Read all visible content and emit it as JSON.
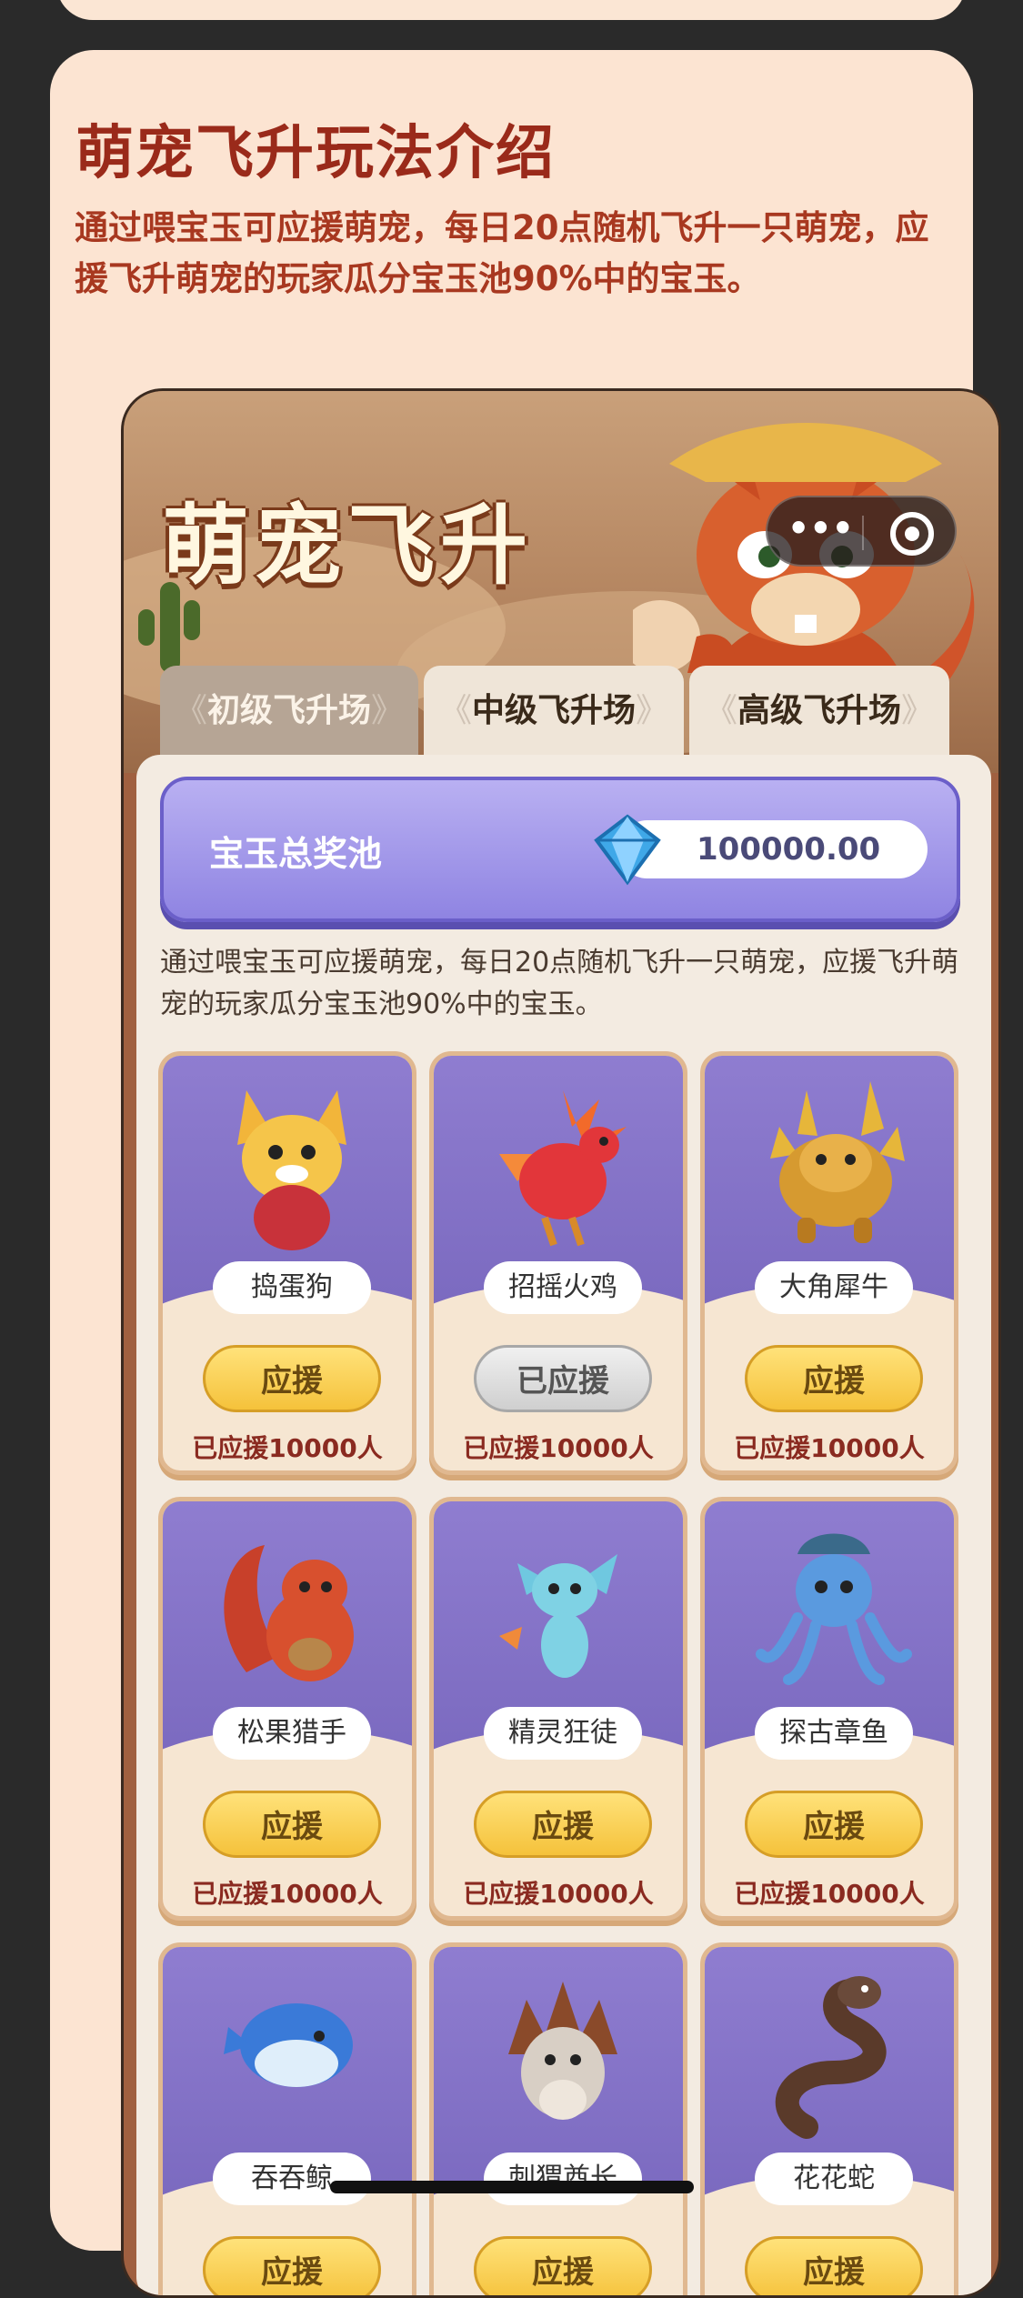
{
  "intro": {
    "title": "萌宠飞升玩法介绍",
    "desc": "通过喂宝玉可应援萌宠，每日20点随机飞升一只萌宠，应援飞升萌宠的玩家瓜分宝玉池90%中的宝玉。"
  },
  "banner": {
    "title": "萌宠飞升",
    "capsule_more": "•••"
  },
  "tabs": [
    {
      "label": "初级飞升场"
    },
    {
      "label": "中级飞升场"
    },
    {
      "label": "高级飞升场"
    }
  ],
  "pool": {
    "label": "宝玉总奖池",
    "value": "100000.00"
  },
  "rules": "通过喂宝玉可应援萌宠，每日20点随机飞升一只萌宠，应援飞升萌宠的玩家瓜分宝玉池90%中的宝玉。",
  "pets": [
    {
      "name": "捣蛋狗",
      "button": "应援",
      "supported": false,
      "count": "已应援10000人",
      "icon": "dog-icon"
    },
    {
      "name": "招摇火鸡",
      "button": "已应援",
      "supported": true,
      "count": "已应援10000人",
      "icon": "fire-bird-icon"
    },
    {
      "name": "大角犀牛",
      "button": "应援",
      "supported": false,
      "count": "已应援10000人",
      "icon": "rhino-icon"
    },
    {
      "name": "松果猎手",
      "button": "应援",
      "supported": false,
      "count": "已应援10000人",
      "icon": "squirrel-icon"
    },
    {
      "name": "精灵狂徒",
      "button": "应援",
      "supported": false,
      "count": "已应援10000人",
      "icon": "sprite-icon"
    },
    {
      "name": "探古章鱼",
      "button": "应援",
      "supported": false,
      "count": "已应援10000人",
      "icon": "octopus-icon"
    },
    {
      "name": "吞吞鲸",
      "button": "应援",
      "supported": false,
      "count": "",
      "icon": "whale-icon"
    },
    {
      "name": "刺猬酋长",
      "button": "应援",
      "supported": false,
      "count": "",
      "icon": "hedgehog-icon"
    },
    {
      "name": "花花蛇",
      "button": "应援",
      "supported": false,
      "count": "",
      "icon": "snake-icon"
    }
  ],
  "colors": {
    "page_bg": "#fce4d2",
    "title": "#9a2a1a",
    "card_purple": "#7a69bf",
    "button_yellow": "#f5c23b"
  }
}
